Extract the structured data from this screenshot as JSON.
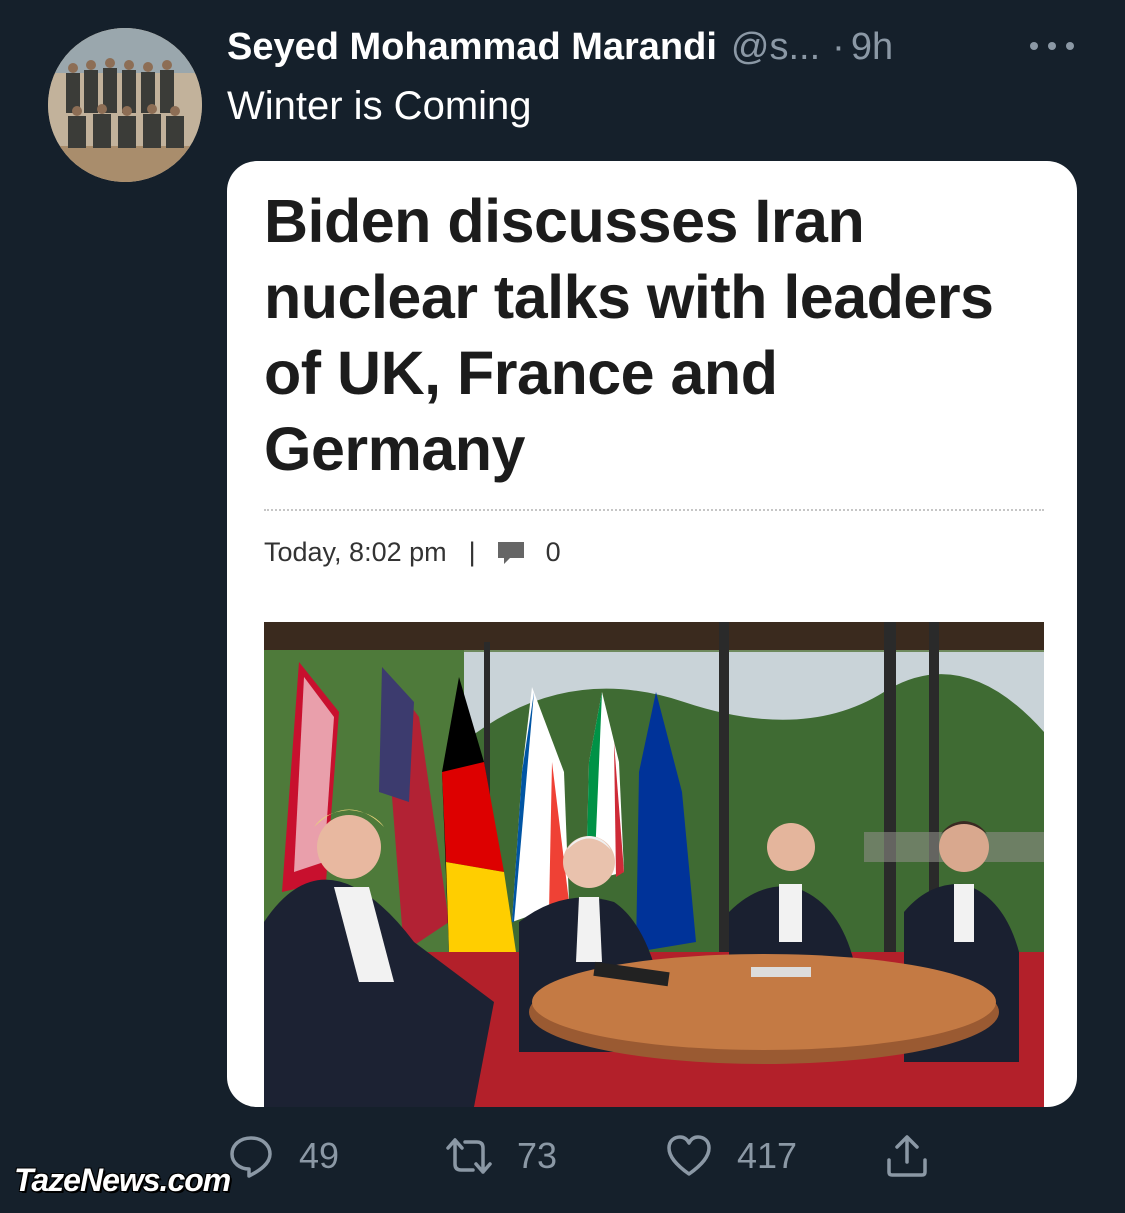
{
  "tweet": {
    "author_name": "Seyed Mohammad Marandi",
    "author_handle": "@s...",
    "separator": "·",
    "time_ago": "9h",
    "text": "Winter is Coming"
  },
  "card": {
    "headline": "Biden discusses Iran nuclear talks with leaders of UK, France and Germany",
    "date": "Today, 8:02 pm",
    "meta_separator": "|",
    "comment_count": "0"
  },
  "actions": {
    "replies": "49",
    "retweets": "73",
    "likes": "417"
  },
  "watermark": "TazeNews.com",
  "icons": {
    "more": "more-dots-icon",
    "reply": "reply-icon",
    "retweet": "retweet-icon",
    "like": "heart-icon",
    "share": "share-icon",
    "comment": "comment-icon"
  },
  "colors": {
    "background": "#15202b",
    "secondary_text": "#8b98a5",
    "card_background": "#ffffff",
    "headline_text": "#1c1c1c"
  }
}
